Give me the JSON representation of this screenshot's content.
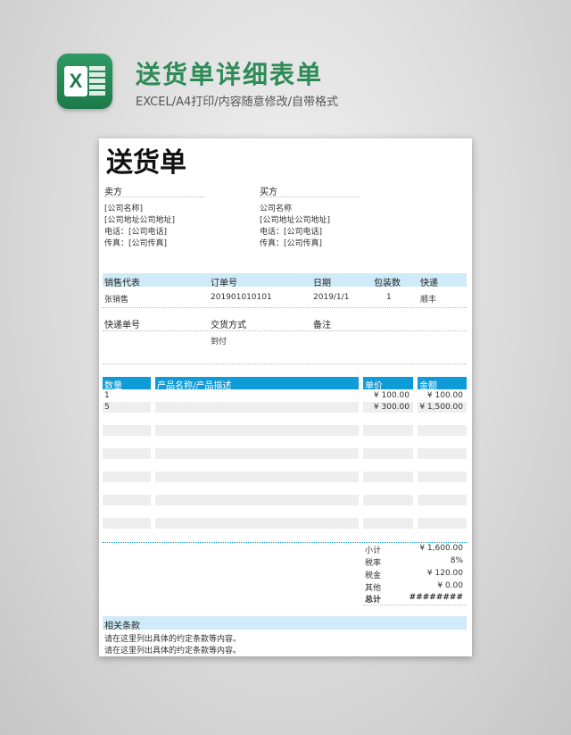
{
  "banner": {
    "title": "送货单详细表单",
    "subtitle": "EXCEL/A4打印/内容随意修改/自带格式",
    "logo_letter": "X"
  },
  "doc": {
    "title": "送货单",
    "seller": {
      "label": "卖方",
      "lines": [
        "[公司名称]",
        "[公司地址公司地址]",
        "电话：[公司电话]",
        "传真：[公司传真]"
      ]
    },
    "buyer": {
      "label": "买方",
      "lines": [
        "公司名称",
        "[公司地址公司地址]",
        "电话：[公司电话]",
        "传真：[公司传真]"
      ]
    },
    "order_headers": [
      "销售代表",
      "订单号",
      "日期",
      "包装数",
      "快递"
    ],
    "order_values": [
      "张销售",
      "201901010101",
      "2019/1/1",
      "1",
      "顺丰"
    ],
    "ship_headers": [
      "快递单号",
      "交货方式",
      "备注"
    ],
    "ship_values": [
      "",
      "到付",
      ""
    ],
    "item_headers": {
      "qty": "数量",
      "desc": "产品名称/产品描述",
      "price": "单价",
      "amount": "金额"
    },
    "items": [
      {
        "qty": "1",
        "desc": "",
        "price": "¥ 100.00",
        "amount": "¥ 100.00"
      },
      {
        "qty": "5",
        "desc": "",
        "price": "¥ 300.00",
        "amount": "¥ 1,500.00"
      }
    ],
    "summary": [
      {
        "label": "小计",
        "value": "¥ 1,600.00"
      },
      {
        "label": "税率",
        "value": "8%"
      },
      {
        "label": "税金",
        "value": "¥ 120.00"
      },
      {
        "label": "其他",
        "value": "¥ 0.00"
      },
      {
        "label": "总计",
        "value": "########"
      }
    ],
    "terms": {
      "label": "相关条款",
      "lines": [
        "请在这里列出具体的约定条款等内容。",
        "请在这里列出具体的约定条款等内容。"
      ]
    }
  }
}
